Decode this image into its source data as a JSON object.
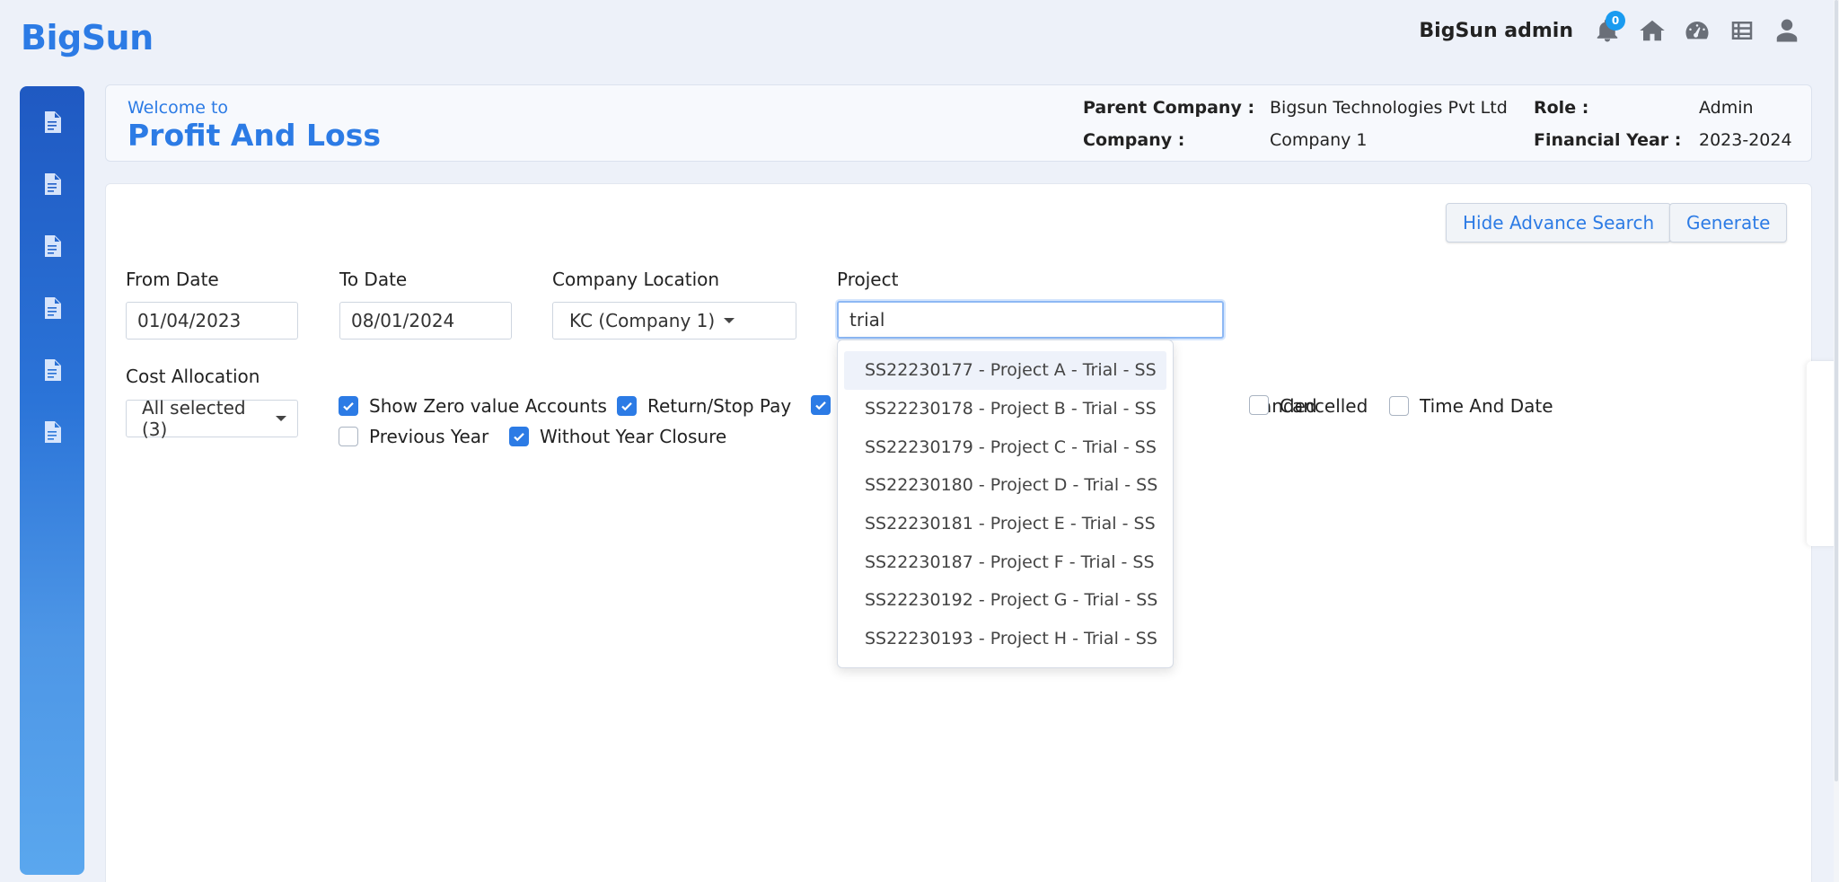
{
  "app": {
    "logo": "BigSun"
  },
  "topbar": {
    "user_name": "BigSun admin",
    "notification_count": "0",
    "icons": [
      "bell-icon",
      "home-icon",
      "dashboard-icon",
      "list-icon",
      "user-icon"
    ]
  },
  "sidebar": {
    "items": [
      "file-icon",
      "file-icon",
      "file-icon",
      "file-icon",
      "file-icon",
      "file-icon"
    ]
  },
  "header": {
    "welcome": "Welcome to",
    "title": "Profit And Loss",
    "parent_company_label": "Parent Company :",
    "parent_company_value": "Bigsun Technologies Pvt Ltd",
    "company_label": "Company :",
    "company_value": "Company 1",
    "role_label": "Role :",
    "role_value": "Admin",
    "fy_label": "Financial Year :",
    "fy_value": "2023-2024"
  },
  "toolbar": {
    "hide_advance_label": "Hide Advance Search",
    "generate_label": "Generate"
  },
  "filters": {
    "from_date_label": "From Date",
    "from_date_value": "01/04/2023",
    "to_date_label": "To Date",
    "to_date_value": "08/01/2024",
    "location_label": "Company Location",
    "location_value": "KC (Company 1)",
    "project_label": "Project",
    "project_value": "trial",
    "cost_allocation_label": "Cost Allocation",
    "cost_allocation_value": "All selected (3)"
  },
  "checkboxes": {
    "show_zero": {
      "label": "Show Zero value Accounts",
      "checked": true
    },
    "return_stop": {
      "label": "Return/Stop Pay",
      "checked": true
    },
    "hidden_checked": {
      "label": "",
      "checked": true
    },
    "andedpartial": {
      "label": "anded",
      "checked": false
    },
    "cancelled": {
      "label": "Cancelled",
      "checked": false
    },
    "time_date": {
      "label": "Time And Date",
      "checked": false
    },
    "previous_year": {
      "label": "Previous Year",
      "checked": false
    },
    "without_closure": {
      "label": "Without Year Closure",
      "checked": true
    }
  },
  "project_dropdown": {
    "items": [
      "SS22230177 - Project A - Trial - SS",
      "SS22230178 - Project B - Trial - SS",
      "SS22230179 - Project C - Trial - SS",
      "SS22230180 - Project D - Trial - SS",
      "SS22230181 - Project E - Trial - SS",
      "SS22230187 - Project F - Trial - SS",
      "SS22230192 - Project G - Trial - SS",
      "SS22230193 - Project H - Trial - SS"
    ]
  },
  "colors": {
    "accent": "#2c7be5",
    "badge": "#1a9bf0"
  }
}
